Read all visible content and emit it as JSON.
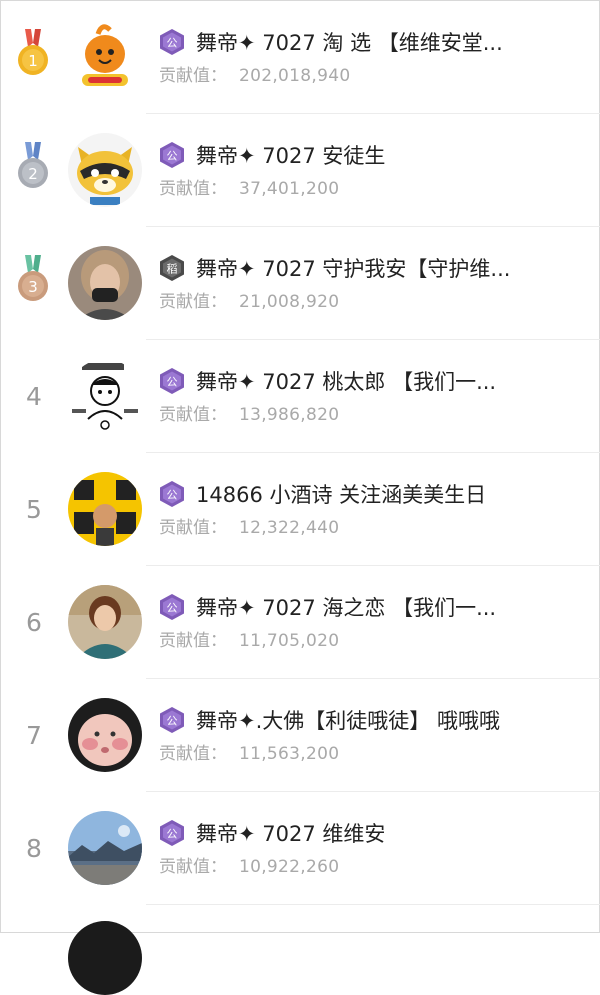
{
  "ranking": {
    "contrib_label": "贡献值：",
    "rows": [
      {
        "rank": "1",
        "medal": "gold",
        "badge": "公",
        "badge_color": "#7f5bb8",
        "name": "舞帝✦ 7027 淘 选 【维维安堂...",
        "value": "202,018,940",
        "avatar": "orange-cartoon-avatar"
      },
      {
        "rank": "2",
        "medal": "silver",
        "badge": "公",
        "badge_color": "#7f5bb8",
        "name": "舞帝✦ 7027 安徒生",
        "value": "37,401,200",
        "avatar": "raccoon-cartoon-avatar"
      },
      {
        "rank": "3",
        "medal": "bronze",
        "badge": "稻",
        "badge_color": "#5a5a5a",
        "name": "舞帝✦ 7027 守护我安【守护维...",
        "value": "21,008,920",
        "avatar": "woman-photo-avatar"
      },
      {
        "rank": "4",
        "medal": "",
        "badge": "公",
        "badge_color": "#7f5bb8",
        "name": "舞帝✦ 7027 桃太郎 【我们一...",
        "value": "13,986,820",
        "avatar": "meme-sketch-avatar"
      },
      {
        "rank": "5",
        "medal": "",
        "badge": "公",
        "badge_color": "#7f5bb8",
        "name": "14866 小酒诗 关注涵美美生日",
        "value": "12,322,440",
        "avatar": "yellow-text-avatar"
      },
      {
        "rank": "6",
        "medal": "",
        "badge": "公",
        "badge_color": "#7f5bb8",
        "name": "舞帝✦ 7027 海之恋 【我们一...",
        "value": "11,705,020",
        "avatar": "person-photo-avatar"
      },
      {
        "rank": "7",
        "medal": "",
        "badge": "公",
        "badge_color": "#7f5bb8",
        "name": "舞帝✦.大佛【利徒哦徒】  哦哦哦",
        "value": "11,563,200",
        "avatar": "face-closeup-avatar"
      },
      {
        "rank": "8",
        "medal": "",
        "badge": "公",
        "badge_color": "#7f5bb8",
        "name": "舞帝✦ 7027 维维安",
        "value": "10,922,260",
        "avatar": "landscape-photo-avatar"
      }
    ]
  },
  "colors": {
    "gold": "#f0b323",
    "silver": "#a7abb3",
    "bronze": "#c99b7c",
    "ribbon_gold": "#e85a4a",
    "ribbon_silver": "#7a9bd6",
    "ribbon_bronze": "#69c2a2",
    "name_text": "#222222",
    "contrib_text": "#a9a9a9",
    "rank_text": "#999999"
  }
}
